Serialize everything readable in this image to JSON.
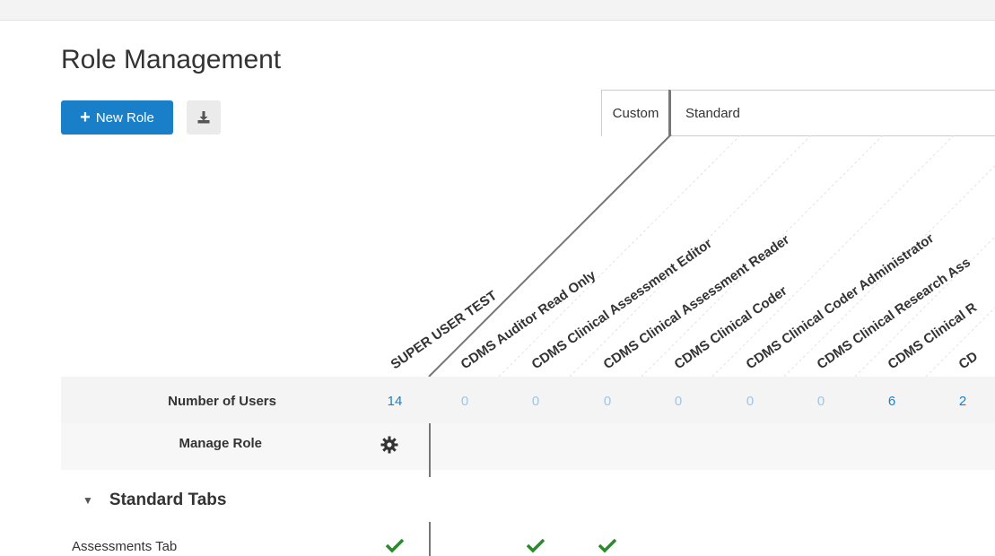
{
  "page": {
    "title": "Role Management"
  },
  "toolbar": {
    "new_role_label": "New Role",
    "download_icon": "download-icon"
  },
  "tabs": [
    {
      "label": "Custom"
    },
    {
      "label": "Standard"
    }
  ],
  "roles": [
    "SUPER USER TEST",
    "CDMS Auditor Read Only",
    "CDMS Clinical Assessment Editor",
    "CDMS Clinical Assessment Reader",
    "CDMS Clinical Coder",
    "CDMS Clinical Coder Administrator",
    "CDMS Clinical Research Ass",
    "CDMS Clinical R",
    "CD"
  ],
  "rows": {
    "number_of_users": {
      "label": "Number of Users",
      "values": [
        "14",
        "0",
        "0",
        "0",
        "0",
        "0",
        "0",
        "6",
        "2"
      ]
    },
    "manage_role": {
      "label": "Manage Role",
      "icon": "gear-icon"
    }
  },
  "section": {
    "label": "Standard Tabs",
    "icon": "caret-down-icon"
  },
  "permissions": [
    {
      "label": "Assessments Tab",
      "checks": [
        true,
        false,
        true,
        true,
        false,
        false,
        false,
        false,
        false
      ]
    }
  ],
  "colors": {
    "primary": "#1a7fc9",
    "check": "#2b8a2b",
    "muted_link": "#9cc7e6"
  }
}
